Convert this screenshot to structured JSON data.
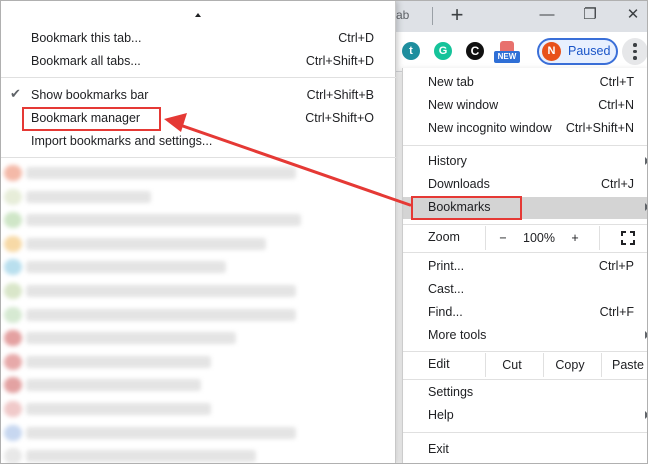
{
  "browser": {
    "tab_fragment": "ab",
    "new_tab_symbol": "+",
    "window_controls": {
      "minimize": "—",
      "restore": "❐",
      "close": "✕"
    },
    "extensions": [
      {
        "name": "t-extension-icon",
        "letter": "t",
        "color": "#1e8e9e"
      },
      {
        "name": "g-extension-icon",
        "letter": "G",
        "color": "#15c39a"
      },
      {
        "name": "moon-extension-icon",
        "letter": "C",
        "color": "#111111"
      }
    ],
    "new_badge": "NEW",
    "profile": {
      "initial": "N",
      "label": "Paused"
    }
  },
  "bookmarks_menu": {
    "items": [
      {
        "label": "Bookmark this tab...",
        "shortcut": "Ctrl+D"
      },
      {
        "label": "Bookmark all tabs...",
        "shortcut": "Ctrl+Shift+D"
      },
      {
        "label": "Show bookmarks bar",
        "shortcut": "Ctrl+Shift+B",
        "checked": true
      },
      {
        "label": "Bookmark manager",
        "shortcut": "Ctrl+Shift+O"
      },
      {
        "label": "Import bookmarks and settings...",
        "shortcut": ""
      }
    ],
    "blurred_favicon_colors": [
      "#f4b9a8",
      "#e7edd9",
      "#cfe6c7",
      "#f7d9a6",
      "#b9dfee",
      "#d9e6c9",
      "#d6e9d2",
      "#e4a1a1",
      "#e7a9a9",
      "#e3a2a2",
      "#f0c9c9",
      "#c7d7f0",
      "#e8e8e8"
    ]
  },
  "main_menu": {
    "new_tab": {
      "label": "New tab",
      "shortcut": "Ctrl+T"
    },
    "new_window": {
      "label": "New window",
      "shortcut": "Ctrl+N"
    },
    "new_incognito": {
      "label": "New incognito window",
      "shortcut": "Ctrl+Shift+N"
    },
    "history": {
      "label": "History"
    },
    "downloads": {
      "label": "Downloads",
      "shortcut": "Ctrl+J"
    },
    "bookmarks": {
      "label": "Bookmarks"
    },
    "zoom": {
      "label": "Zoom",
      "minus": "−",
      "value": "100%",
      "plus": "+"
    },
    "print": {
      "label": "Print...",
      "shortcut": "Ctrl+P"
    },
    "cast": {
      "label": "Cast..."
    },
    "find": {
      "label": "Find...",
      "shortcut": "Ctrl+F"
    },
    "more_tools": {
      "label": "More tools"
    },
    "edit": {
      "label": "Edit",
      "cut": "Cut",
      "copy": "Copy",
      "paste": "Paste"
    },
    "settings": {
      "label": "Settings"
    },
    "help": {
      "label": "Help"
    },
    "exit": {
      "label": "Exit"
    }
  },
  "colors": {
    "annotation_red": "#e53935",
    "highlight_gray": "#d4d4d4",
    "profile_blue": "#3a6fd8"
  }
}
